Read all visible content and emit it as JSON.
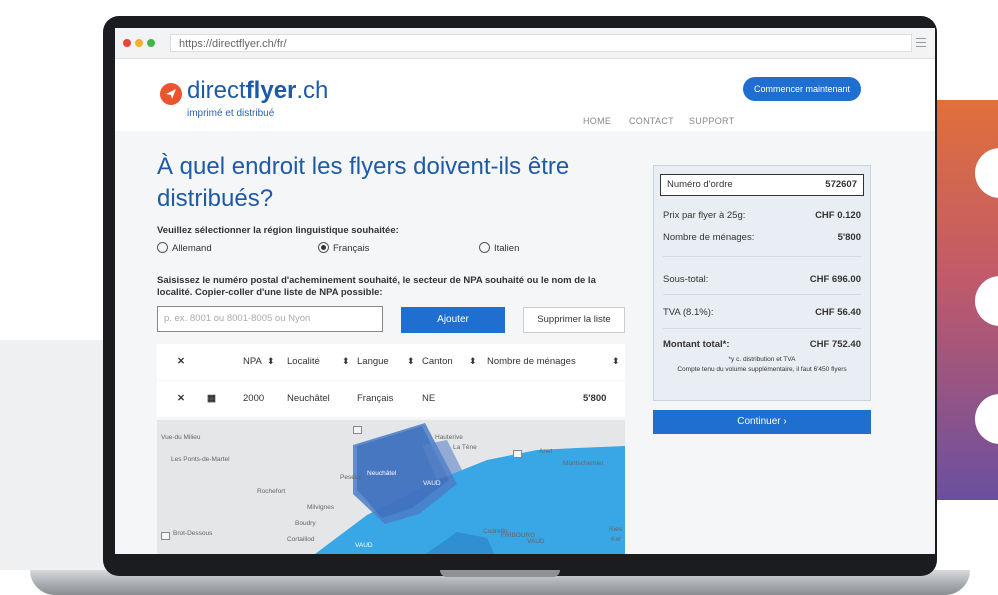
{
  "browser": {
    "url": "https://directflyer.ch/fr/"
  },
  "header": {
    "logo_prefix": "direct",
    "logo_bold": "flyer",
    "logo_suffix": ".ch",
    "tagline": "imprimé et distribué",
    "nav": [
      "HOME",
      "CONTACT",
      "SUPPORT"
    ],
    "cta_label": "Commencer maintenant"
  },
  "main": {
    "title": "À quel endroit les flyers doivent-ils être distribués?",
    "region_label": "Veuillez sélectionner la région linguistique souhaitée:",
    "regions": [
      {
        "label": "Allemand",
        "selected": false
      },
      {
        "label": "Français",
        "selected": true
      },
      {
        "label": "Italien",
        "selected": false
      }
    ],
    "npa_description": "Saisissez le numéro postal d'acheminement souhaité, le secteur de NPA souhaité ou le nom de la localité. Copier-coller d'une liste de NPA possible:",
    "npa_placeholder": "p. ex. 8001 ou 8001-8005 ou Nyon",
    "add_label": "Ajouter",
    "clear_label": "Supprimer la liste",
    "table": {
      "headers": [
        "NPA",
        "Localité",
        "Langue",
        "Canton",
        "Nombre de ménages"
      ],
      "rows": [
        {
          "npa": "2000",
          "localite": "Neuchâtel",
          "langue": "Français",
          "canton": "NE",
          "menages": "5'800"
        }
      ]
    },
    "map_labels": [
      "Vue-du Milieu",
      "Les Ponts-de-Martel",
      "Rochefort",
      "Milvignes",
      "Boudry",
      "Cortaillod",
      "Brot-Dessous",
      "Peseux",
      "Neuchâtel",
      "Hauterive",
      "La Tène",
      "Anet",
      "Müntschemier",
      "Cudrefin",
      "VAUD",
      "FRIBOURG",
      "VAUD",
      "VAUD",
      "Ries",
      "Ker"
    ]
  },
  "summary": {
    "order_label": "Numéro d'ordre",
    "order_value": "572607",
    "price_label": "Prix par flyer à 25g:",
    "price_value": "CHF 0.120",
    "households_label": "Nombre de ménages:",
    "households_value": "5'800",
    "subtotal_label": "Sous-total:",
    "subtotal_value": "CHF 696.00",
    "tva_label": "TVA (8.1%):",
    "tva_value": "CHF 56.40",
    "total_label": "Montant total*:",
    "total_value": "CHF 752.40",
    "note_1": "*y c. distribution et TVA",
    "note_2": "Compte tenu du volume supplémentaire, il faut 6'450 flyers",
    "continue_label": "Continuer ›"
  },
  "colors": {
    "brand_blue": "#1f6fd0",
    "logo_orange": "#e8552f",
    "map_water": "#39a7e6"
  }
}
